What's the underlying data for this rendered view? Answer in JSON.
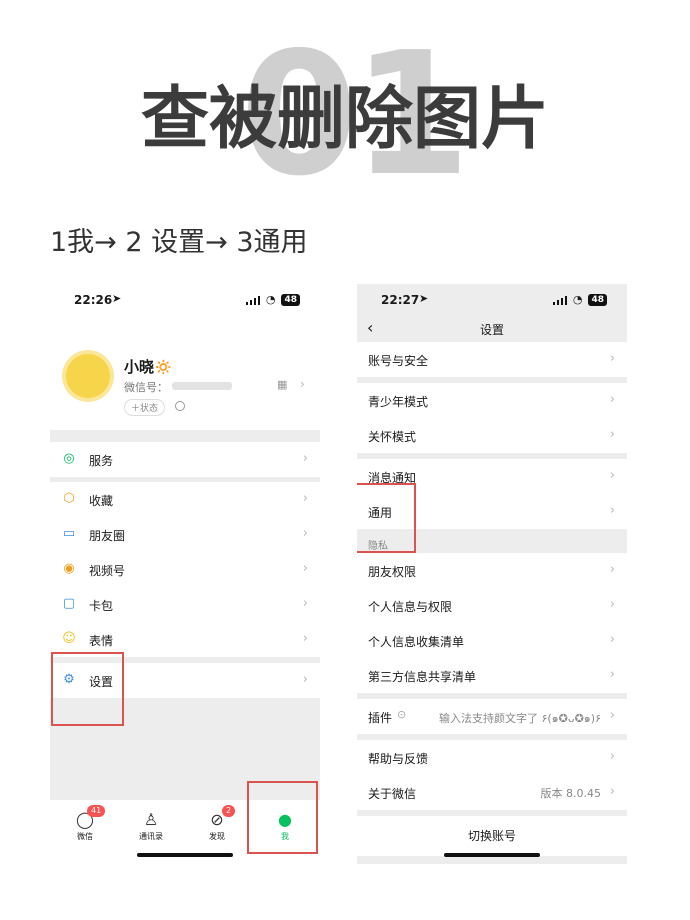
{
  "header": {
    "number": "01",
    "title": "查被删除图片",
    "steps": "1我→ 2 设置→ 3通用"
  },
  "left_phone": {
    "status_time": "22:26",
    "battery": "48",
    "profile": {
      "name": "小晓🔅",
      "wechat_id_label": "微信号：",
      "status_button": "＋状态"
    },
    "menu": [
      {
        "label": "服务",
        "icon": "service-icon"
      },
      {
        "label": "收藏",
        "icon": "favorites-icon"
      },
      {
        "label": "朋友圈",
        "icon": "moments-icon"
      },
      {
        "label": "视频号",
        "icon": "channels-icon"
      },
      {
        "label": "卡包",
        "icon": "cards-icon"
      },
      {
        "label": "表情",
        "icon": "stickers-icon"
      },
      {
        "label": "设置",
        "icon": "settings-icon"
      }
    ],
    "tabs": [
      {
        "label": "微信",
        "badge": "41"
      },
      {
        "label": "通讯录",
        "badge": ""
      },
      {
        "label": "发现",
        "badge": "2"
      },
      {
        "label": "我",
        "badge": ""
      }
    ]
  },
  "right_phone": {
    "status_time": "22:27",
    "battery": "48",
    "nav_title": "设置",
    "items": {
      "account_security": "账号与安全",
      "teen_mode": "青少年模式",
      "care_mode": "关怀模式",
      "notifications": "消息通知",
      "general": "通用",
      "privacy_header": "隐私",
      "friend_permissions": "朋友权限",
      "personal_info": "个人信息与权限",
      "info_collection": "个人信息收集清单",
      "third_party": "第三方信息共享清单",
      "plugins": "插件",
      "plugins_value": "输入法支持颜文字了 ۶(๑✪ᴗ✪๑)۶",
      "help": "帮助与反馈",
      "about": "关于微信",
      "about_value": "版本 8.0.45",
      "switch_account": "切换账号"
    }
  },
  "colors": {
    "wechat_green": "#07c160",
    "highlight_red": "#d9534f",
    "badge_red": "#fa5151"
  }
}
